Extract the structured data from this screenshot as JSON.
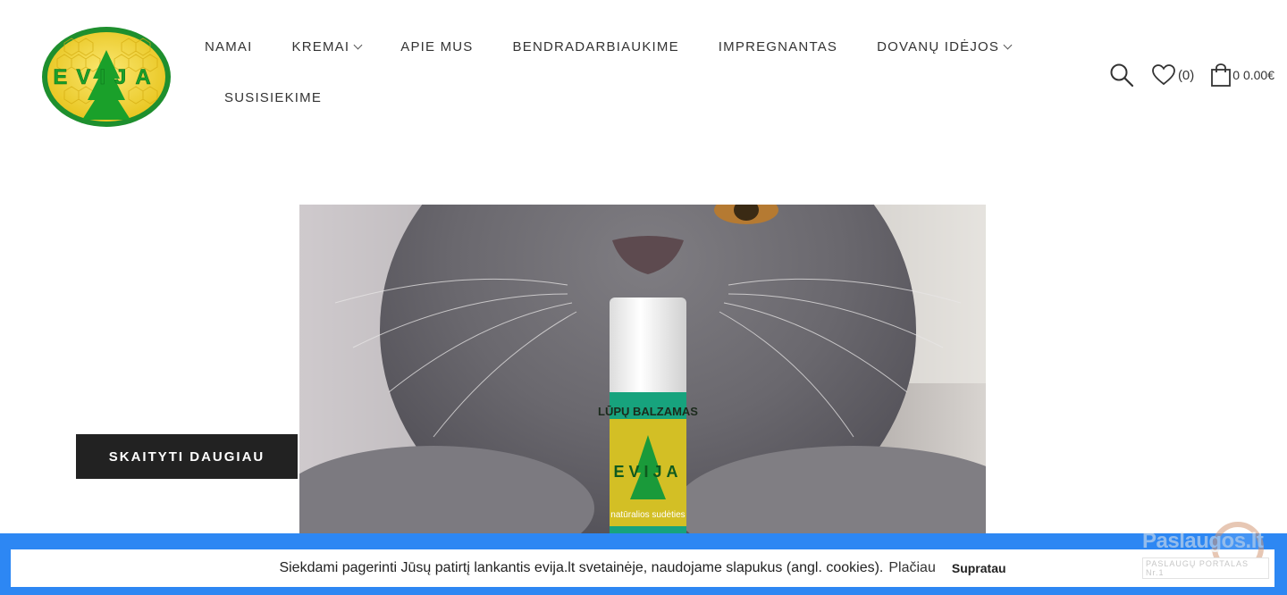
{
  "logo": {
    "text": "EVIJA"
  },
  "nav": {
    "row1": [
      {
        "label": "NAMAI",
        "dropdown": false
      },
      {
        "label": "KREMAI",
        "dropdown": true
      },
      {
        "label": "APIE MUS",
        "dropdown": false
      },
      {
        "label": "BENDRADARBIAUKIME",
        "dropdown": false
      },
      {
        "label": "IMPREGNANTAS",
        "dropdown": false
      },
      {
        "label": "DOVANŲ IDĖJOS",
        "dropdown": true
      }
    ],
    "row2": [
      {
        "label": "SUSISIEKIME",
        "dropdown": false
      }
    ]
  },
  "header_icons": {
    "search": "search-icon",
    "wishlist_count": "(0)",
    "cart_text": "0 0.00€"
  },
  "hero": {
    "product_label_1": "LŪPŲ BALZAMAS",
    "product_label_2": "EVIJA",
    "product_label_3": "natūralios sudėties"
  },
  "buttons": {
    "read_more": "SKAITYTI DAUGIAU"
  },
  "cookie": {
    "text": "Siekdami pagerinti Jūsų patirtį lankantis evija.lt svetainėje, naudojame slapukus (angl. cookies).",
    "more": "Plačiau",
    "accept": "Supratau"
  },
  "watermark": {
    "text": "Paslaugos.lt",
    "sub": "PASLAUGŲ PORTALAS Nr.1"
  },
  "colors": {
    "cookie_bar": "#2d87f3",
    "button": "#222222",
    "logo_green": "#1aa02a",
    "logo_yellow": "#f2d21b"
  }
}
